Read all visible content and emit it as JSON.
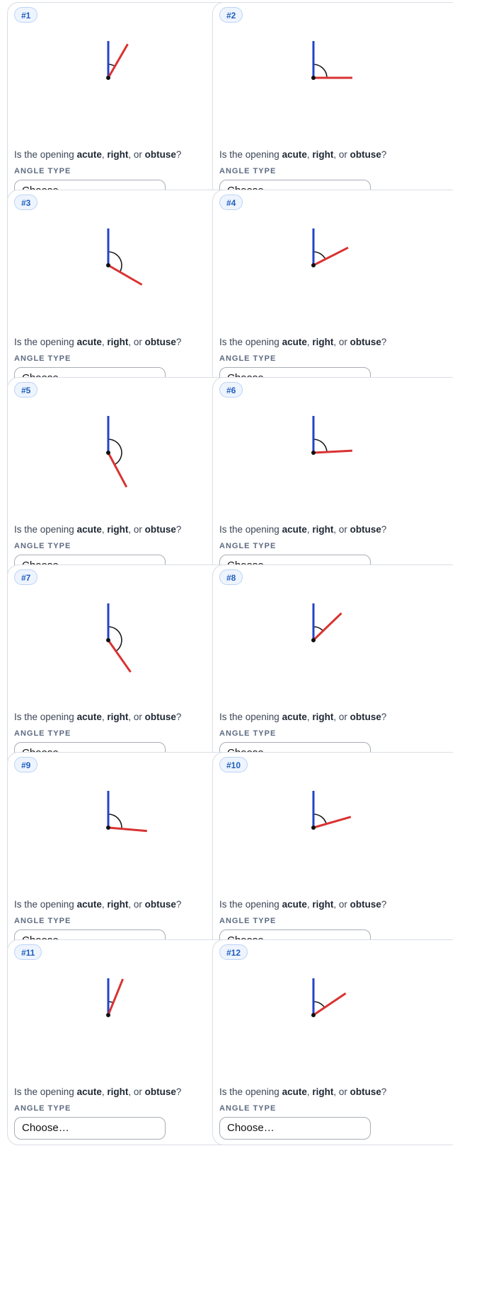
{
  "question": {
    "prefix": "Is the opening ",
    "acute": "acute",
    "sep1": ", ",
    "right": "right",
    "sep2": ", or ",
    "obtuse": "obtuse",
    "suffix": "?"
  },
  "field_label": "ANGLE TYPE",
  "select_placeholder": "Choose…",
  "colors": {
    "reference_ray": "#2343c9",
    "moving_ray": "#d93232",
    "arc": "#1a1a1a",
    "vertex": "#111111"
  },
  "cards": [
    {
      "badge": "#1",
      "angle_deg": 30
    },
    {
      "badge": "#2",
      "angle_deg": 90
    },
    {
      "badge": "#3",
      "angle_deg": 120
    },
    {
      "badge": "#4",
      "angle_deg": 63
    },
    {
      "badge": "#5",
      "angle_deg": 152
    },
    {
      "badge": "#6",
      "angle_deg": 87
    },
    {
      "badge": "#7",
      "angle_deg": 145
    },
    {
      "badge": "#8",
      "angle_deg": 46
    },
    {
      "badge": "#9",
      "angle_deg": 95
    },
    {
      "badge": "#10",
      "angle_deg": 74
    },
    {
      "badge": "#11",
      "angle_deg": 22
    },
    {
      "badge": "#12",
      "angle_deg": 56
    }
  ]
}
